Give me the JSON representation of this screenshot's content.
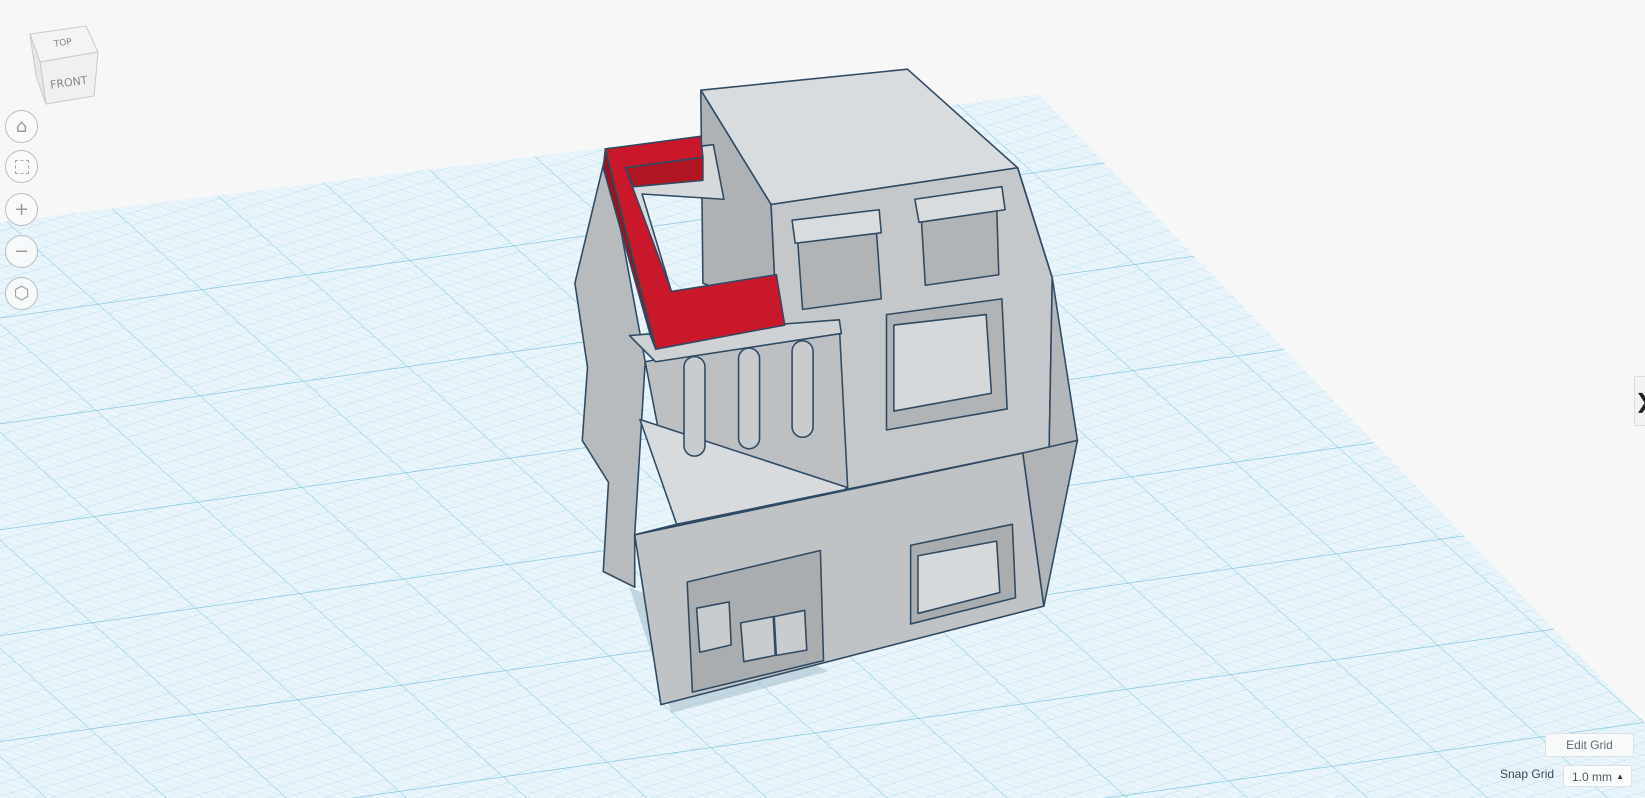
{
  "viewcube": {
    "top_label": "TOP",
    "front_label": "FRONT"
  },
  "nav": [
    {
      "name": "home-view",
      "icon": "home-icon"
    },
    {
      "name": "fit-all",
      "icon": "fit-frame-icon"
    },
    {
      "name": "zoom-in",
      "icon": "plus-icon"
    },
    {
      "name": "zoom-out",
      "icon": "minus-icon"
    },
    {
      "name": "perspective-toggle",
      "icon": "cube-icon"
    }
  ],
  "panel_toggle": {
    "glyph": "❯"
  },
  "grid_controls": {
    "edit_grid_label": "Edit Grid",
    "snap_grid_label": "Snap Grid",
    "snap_grid_value": "1.0 mm"
  },
  "colors": {
    "grid_bg": "#e6f3f9",
    "grid_line": "#9fd3ea",
    "shape_gray": "#c3c6c8",
    "shape_edge": "#2f4a63",
    "selected_red": "#c8182a"
  }
}
